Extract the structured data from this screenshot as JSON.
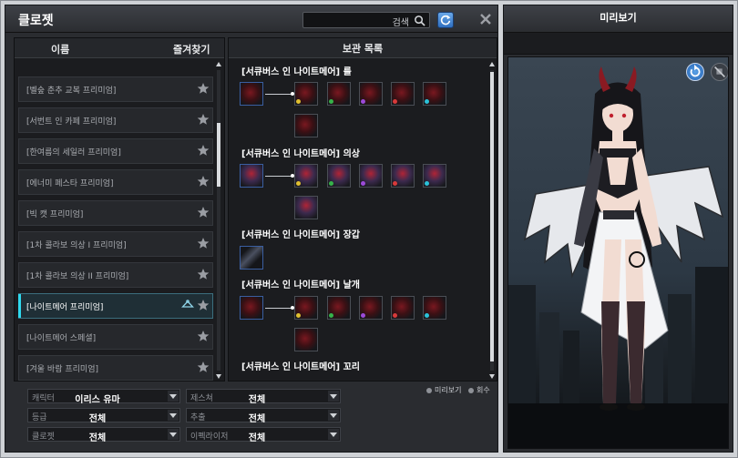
{
  "closet": {
    "title": "클로젯",
    "search_label": "검색"
  },
  "list": {
    "col_name": "이름",
    "col_fav": "즐겨찾기",
    "items": [
      {
        "label": "[벨숲 춘추 교복 프리미엄]"
      },
      {
        "label": "[서번트 인 카페 프리미엄]"
      },
      {
        "label": "[한여름의 세일러 프리미엄]"
      },
      {
        "label": "[에너미 페스타 프리미엄]"
      },
      {
        "label": "[빅 캣 프리미엄]"
      },
      {
        "label": "[1차 콜라보 의상 I 프리미엄]"
      },
      {
        "label": "[1차 콜라보 의상 II 프리미엄]"
      },
      {
        "label": "[나이트메어 프리미엄]"
      },
      {
        "label": "[나이트메어 스페셜]"
      },
      {
        "label": "[겨울 바람 프리미엄]"
      }
    ],
    "selected_index": 7
  },
  "storage": {
    "title": "보관 목록",
    "sections": [
      {
        "label": "[서큐버스 인 나이트메어] 룰"
      },
      {
        "label": "[서큐버스 인 나이트메어] 의상"
      },
      {
        "label": "[서큐버스 인 나이트메어] 장갑"
      },
      {
        "label": "[서큐버스 인 나이트메어] 날개"
      },
      {
        "label": "[서큐버스 인 나이트메어] 꼬리"
      }
    ]
  },
  "options": {
    "preview_label": "미리보기",
    "count_label": "회수"
  },
  "filters": [
    {
      "key": "캐릭터",
      "value": "이리스 유마"
    },
    {
      "key": "제스쳐",
      "value": "전체"
    },
    {
      "key": "등급",
      "value": "전체"
    },
    {
      "key": "추출",
      "value": "전체"
    },
    {
      "key": "클로젯",
      "value": "전체"
    },
    {
      "key": "이펙라이저",
      "value": "전체"
    }
  ],
  "preview": {
    "title": "미리보기"
  },
  "colors": {
    "accent": "#2fd9ee",
    "button_blue": "#2f6fc0"
  }
}
